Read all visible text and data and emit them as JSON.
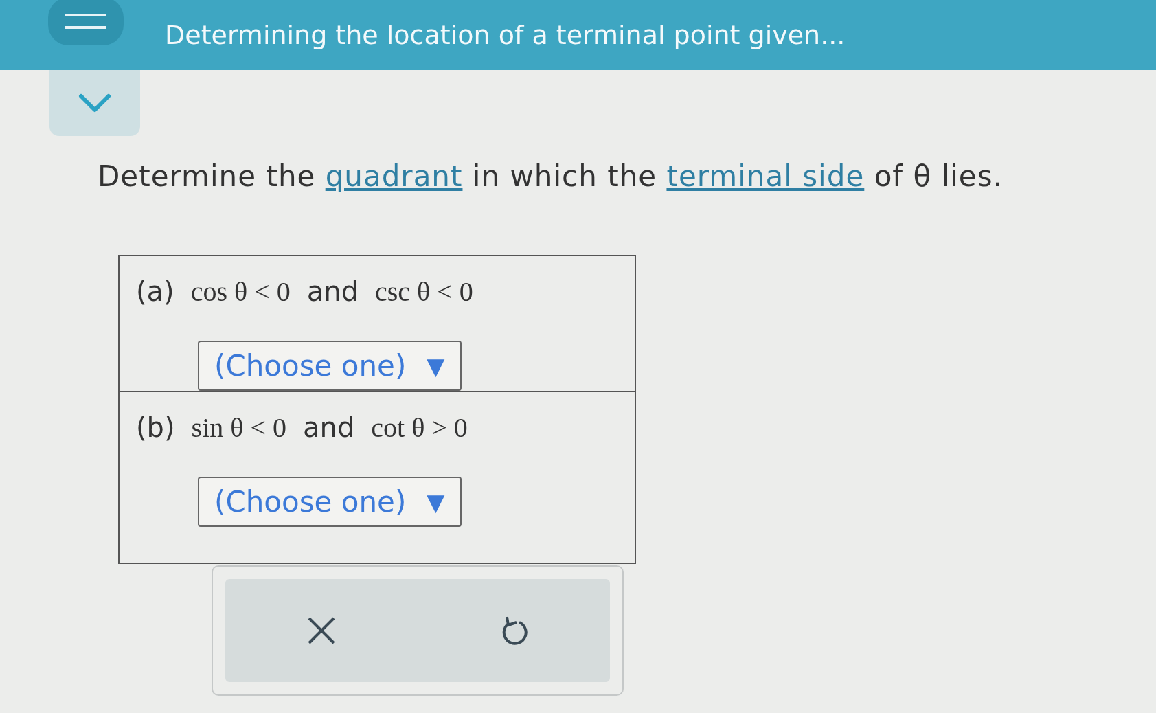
{
  "header": {
    "title": "Determining the location of a terminal point given..."
  },
  "question": {
    "segments": [
      {
        "kind": "text",
        "text": "Determine the "
      },
      {
        "kind": "link",
        "text": "quadrant"
      },
      {
        "kind": "text",
        "text": " in which the "
      },
      {
        "kind": "link",
        "text": "terminal side"
      },
      {
        "kind": "text",
        "text": " of θ lies."
      }
    ]
  },
  "parts": [
    {
      "label": "(a)",
      "expression": [
        {
          "kind": "math",
          "text": "cos θ < 0"
        },
        {
          "kind": "text",
          "text": "and"
        },
        {
          "kind": "math",
          "text": "csc θ < 0"
        }
      ],
      "dropdown": {
        "value": "(Choose one)",
        "arrow": "▼"
      }
    },
    {
      "label": "(b)",
      "expression": [
        {
          "kind": "math",
          "text": "sin θ < 0"
        },
        {
          "kind": "text",
          "text": "and"
        },
        {
          "kind": "math",
          "text": "cot θ > 0"
        }
      ],
      "dropdown": {
        "value": "(Choose one)",
        "arrow": "▼"
      }
    }
  ],
  "actions": [
    {
      "kind": "clear"
    },
    {
      "kind": "undo"
    }
  ]
}
